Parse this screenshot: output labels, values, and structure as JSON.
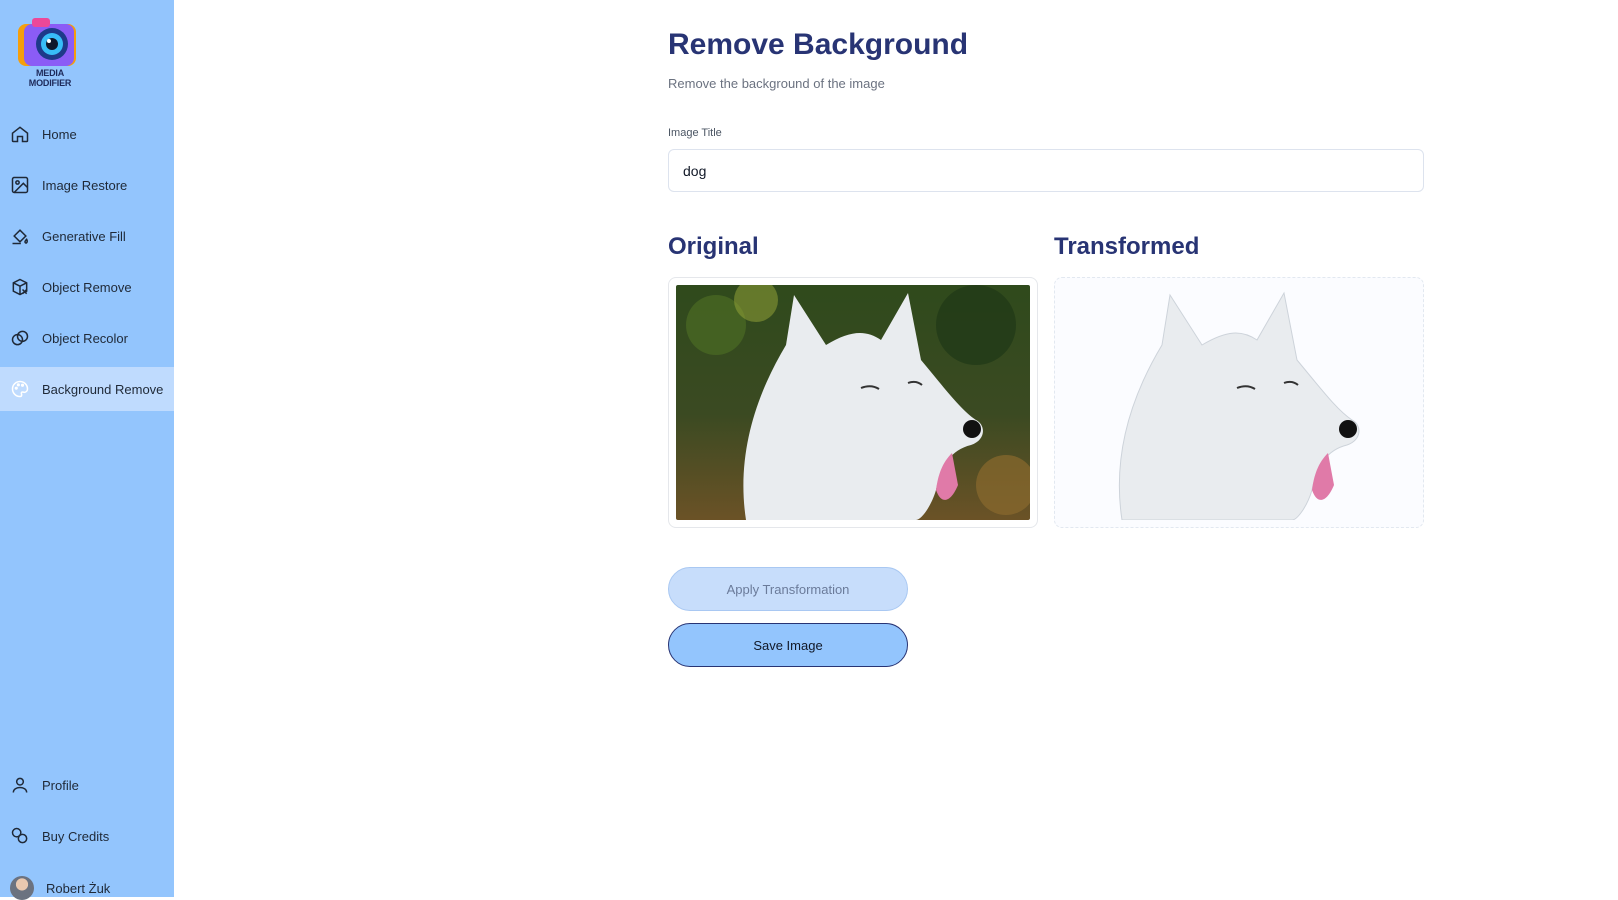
{
  "app": {
    "logo_text": "MEDIA MODIFIER"
  },
  "sidebar": {
    "items": [
      {
        "label": "Home",
        "icon": "home-icon",
        "active": false
      },
      {
        "label": "Image Restore",
        "icon": "image-restore-icon",
        "active": false
      },
      {
        "label": "Generative Fill",
        "icon": "paint-bucket-icon",
        "active": false
      },
      {
        "label": "Object Remove",
        "icon": "box-remove-icon",
        "active": false
      },
      {
        "label": "Object Recolor",
        "icon": "recolor-icon",
        "active": false
      },
      {
        "label": "Background Remove",
        "icon": "palette-icon",
        "active": true
      }
    ],
    "bottom_items": [
      {
        "label": "Profile",
        "icon": "user-icon"
      },
      {
        "label": "Buy Credits",
        "icon": "coins-icon"
      }
    ],
    "user": {
      "name": "Robert Żuk"
    }
  },
  "main": {
    "title": "Remove Background",
    "subtitle": "Remove the background of the image",
    "field": {
      "label": "Image Title",
      "value": "dog"
    },
    "original_title": "Original",
    "transformed_title": "Transformed",
    "apply_label": "Apply Transformation",
    "save_label": "Save Image"
  },
  "colors": {
    "sidebar": "#93c5fd",
    "active_item": "#bfdbfe",
    "heading": "#283474"
  }
}
